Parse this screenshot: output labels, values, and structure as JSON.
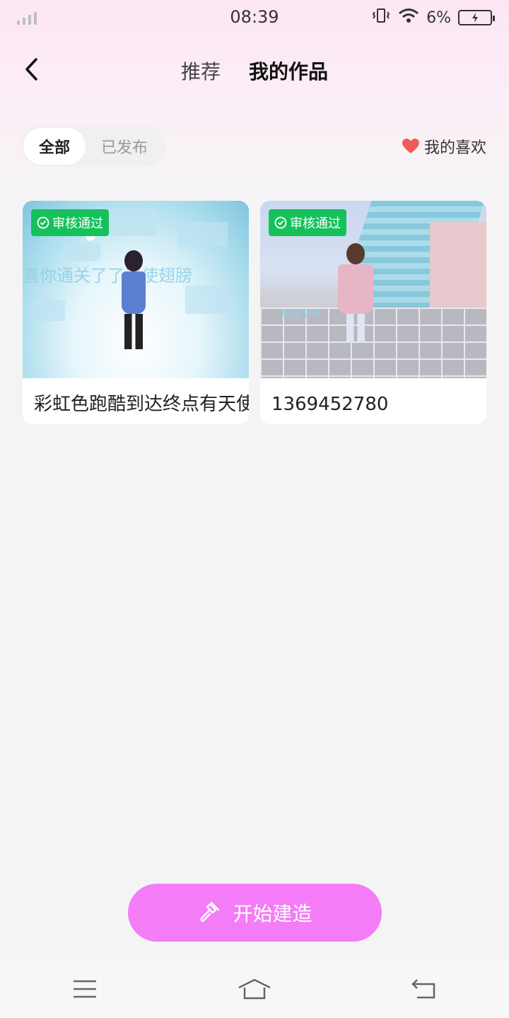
{
  "status_bar": {
    "time": "08:39",
    "battery": "6%"
  },
  "nav": {
    "tabs": [
      {
        "label": "推荐"
      },
      {
        "label": "我的作品"
      }
    ]
  },
  "filter": {
    "segments": [
      {
        "label": "全部"
      },
      {
        "label": "已发布"
      }
    ],
    "favorites_label": "我的喜欢"
  },
  "cards": [
    {
      "badge": "审核通过",
      "title": "彩虹色跑酷到达终点有天使翅膀，购毒 白白",
      "thumb_text": "喜你通关了了天使翅膀"
    },
    {
      "badge": "审核通过",
      "title": "1369452780",
      "thumb_text": "樱花学校"
    }
  ],
  "build_button": {
    "label": "开始建造"
  },
  "colors": {
    "badge": "#16c15b",
    "build": "#f57cf7",
    "heart": "#f05a5a"
  }
}
